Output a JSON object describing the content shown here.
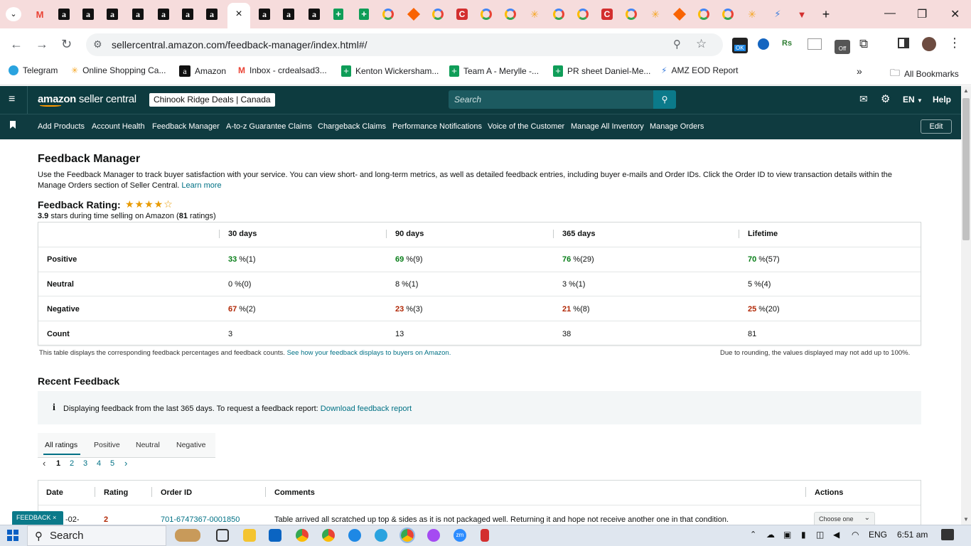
{
  "browser": {
    "url": "sellercentral.amazon.com/feedback-manager/index.html#/",
    "bookmarks": [
      "Telegram",
      "Online Shopping Ca...",
      "Amazon",
      "Inbox - crdealsad3...",
      "Kenton Wickersham...",
      "Team A - Merylle -...",
      "PR sheet Daniel-Me...",
      "AMZ EOD Report"
    ],
    "all_bookmarks": "All Bookmarks",
    "more": "»",
    "ext_ok": "OK",
    "ext_rs": "Rs",
    "ext_off": "Off"
  },
  "seller": {
    "logo_main": "amazon",
    "logo_sub": " seller central",
    "store": "Chinook Ridge Deals | Canada",
    "search_placeholder": "Search",
    "lang": "EN",
    "help": "Help",
    "edit": "Edit",
    "nav": [
      "Add Products",
      "Account Health",
      "Feedback Manager",
      "A-to-z Guarantee Claims",
      "Chargeback Claims",
      "Performance Notifications",
      "Voice of the Customer",
      "Manage All Inventory",
      "Manage Orders"
    ]
  },
  "feedback": {
    "title": "Feedback Manager",
    "intro": "Use the Feedback Manager to track buyer satisfaction with your service. You can view short- and long-term metrics, as well as detailed feedback entries, including buyer e-mails and Order IDs. Click the Order ID to view transaction details within the Manage Orders section of Seller Central.",
    "learn_more": "Learn more",
    "rating_label": "Feedback Rating:",
    "stars": "★★★★☆",
    "rating_value": "3.9",
    "rating_text": " stars during time selling on Amazon (",
    "rating_count": "81",
    "rating_tail": " ratings)",
    "columns": [
      "30 days",
      "90 days",
      "365 days",
      "Lifetime"
    ],
    "rows": [
      {
        "label": "Positive",
        "cells": [
          {
            "v": "33",
            "s": " %(1)"
          },
          {
            "v": "69",
            "s": " %(9)"
          },
          {
            "v": "76",
            "s": " %(29)"
          },
          {
            "v": "70",
            "s": " %(57)"
          }
        ]
      },
      {
        "label": "Neutral",
        "cells": [
          {
            "v": "0",
            "s": " %(0)"
          },
          {
            "v": "8",
            "s": " %(1)"
          },
          {
            "v": "3",
            "s": " %(1)"
          },
          {
            "v": "5",
            "s": " %(4)"
          }
        ]
      },
      {
        "label": "Negative",
        "cells": [
          {
            "v": "67",
            "s": " %(2)"
          },
          {
            "v": "23",
            "s": " %(3)"
          },
          {
            "v": "21",
            "s": " %(8)"
          },
          {
            "v": "25",
            "s": " %(20)"
          }
        ]
      },
      {
        "label": "Count",
        "cells": [
          {
            "v": "3",
            "s": ""
          },
          {
            "v": "13",
            "s": ""
          },
          {
            "v": "38",
            "s": ""
          },
          {
            "v": "81",
            "s": ""
          }
        ]
      }
    ],
    "note_left": "This table displays the corresponding feedback percentages and feedback counts.",
    "note_link": "See how your feedback displays to buyers on Amazon.",
    "note_right": "Due to rounding, the values displayed may not add up to 100%."
  },
  "recent": {
    "title": "Recent Feedback",
    "info_icon": "i",
    "info": "Displaying feedback from the last 365 days. To request a feedback report:",
    "info_link": "Download feedback report",
    "tabs": [
      "All ratings",
      "Positive",
      "Neutral",
      "Negative"
    ],
    "pages": [
      "1",
      "2",
      "3",
      "4",
      "5"
    ],
    "prev": "‹",
    "next": "›",
    "headers": [
      "Date",
      "Rating",
      "Order ID",
      "Comments",
      "Actions"
    ],
    "row": {
      "date": "-02-",
      "rating": "2",
      "order": "701-6747367-0001850",
      "comment": "Table arrived all scratched up top & sides as it is not packaged well. Returning it and hope not receive another one in that condition.",
      "action": "Choose one"
    },
    "feedback_tab": "FEEDBACK ×"
  },
  "taskbar": {
    "search": "Search",
    "lang": "ENG",
    "time": "6:51 am",
    "zoom_icon": "zm"
  }
}
